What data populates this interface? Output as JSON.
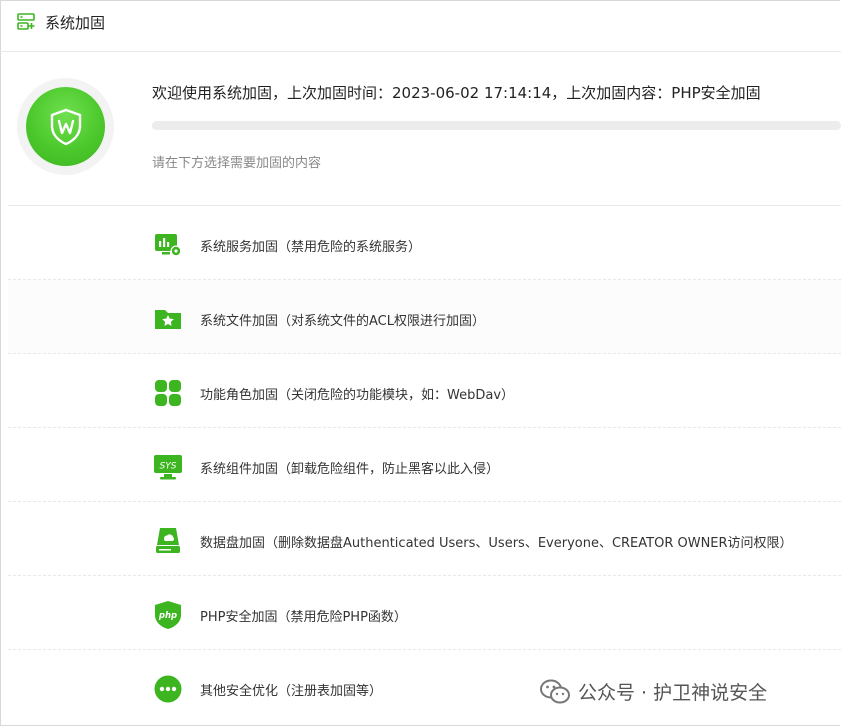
{
  "header": {
    "title": "系统加固",
    "icon": "server-plus-icon"
  },
  "status": {
    "welcome_text": "欢迎使用系统加固，上次加固时间：2023-06-02 17:14:14，上次加固内容：PHP安全加固",
    "hint": "请在下方选择需要加固的内容",
    "progress_percent": 0,
    "badge_icon": "shield-w-icon"
  },
  "items": [
    {
      "label": "系统服务加固（禁用危险的系统服务）",
      "icon": "monitor-gear-icon"
    },
    {
      "label": "系统文件加固（对系统文件的ACL权限进行加固）",
      "icon": "folder-star-icon"
    },
    {
      "label": "功能角色加固（关闭危险的功能模块，如：WebDav）",
      "icon": "four-squares-icon"
    },
    {
      "label": "系统组件加固（卸载危险组件，防止黑客以此入侵）",
      "icon": "sys-monitor-icon"
    },
    {
      "label": "数据盘加固（删除数据盘Authenticated Users、Users、Everyone、CREATOR OWNER访问权限）",
      "icon": "disk-icon"
    },
    {
      "label": "PHP安全加固（禁用危险PHP函数）",
      "icon": "php-shield-icon"
    },
    {
      "label": "其他安全优化（注册表加固等）",
      "icon": "more-dots-icon"
    }
  ],
  "watermark": {
    "text": "公众号 · 护卫神说安全",
    "icon": "wechat-icon"
  },
  "colors": {
    "accent": "#3cb520",
    "accent_light": "#5ad23a"
  }
}
